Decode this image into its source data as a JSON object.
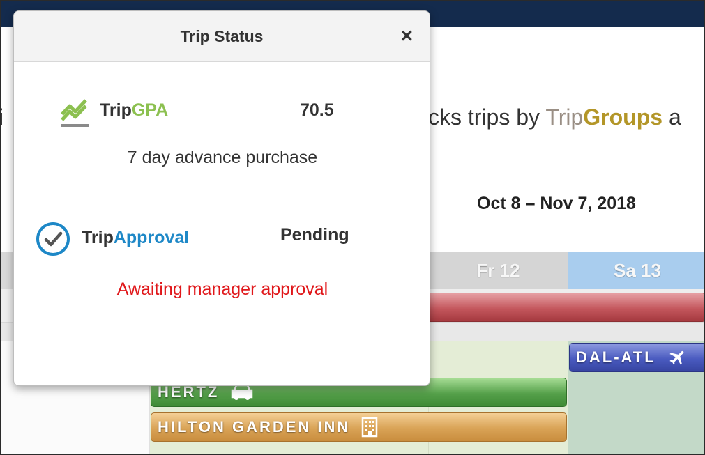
{
  "background": {
    "text_left": "i",
    "text_mid_prefix": "cks trips by ",
    "text_mid_trip": "Trip",
    "text_mid_groups": "Groups",
    "text_mid_suffix": " a",
    "date_range": "Oct 8 – Nov 7, 2018"
  },
  "calendar": {
    "days": [
      {
        "label": "Fr 12"
      },
      {
        "label": "Sa 13"
      }
    ],
    "events": {
      "flight": {
        "label": "DAL-ATL",
        "icon": "airplane-icon"
      },
      "car": {
        "label": "HERTZ",
        "icon": "car-icon"
      },
      "hotel": {
        "label": "HILTON GARDEN INN",
        "icon": "building-icon"
      }
    },
    "colors": {
      "trip_bar": "#c4575d",
      "flight": "#4a5bc0",
      "car": "#55a04a",
      "hotel": "#d9a356",
      "selected_day": "#a9cdee"
    }
  },
  "modal": {
    "title": "Trip Status",
    "close_icon": "close-icon",
    "gpa": {
      "label_prefix": "Trip",
      "label_suffix": "GPA",
      "value": "70.5",
      "note": "7 day advance purchase",
      "icon": "trend-chart-icon",
      "accent": "#8cc050"
    },
    "approval": {
      "label_prefix": "Trip",
      "label_suffix": "Approval",
      "value": "Pending",
      "note": "Awaiting manager approval",
      "icon": "check-circle-icon",
      "accent": "#1e88c7",
      "note_color": "#e0171a"
    }
  }
}
